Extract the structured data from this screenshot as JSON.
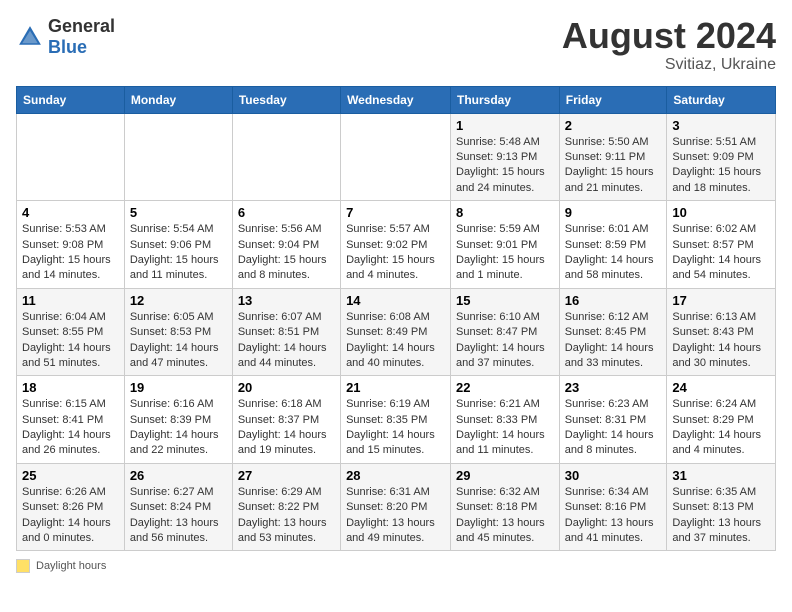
{
  "logo": {
    "general": "General",
    "blue": "Blue"
  },
  "title": "August 2024",
  "subtitle": "Svitiaz, Ukraine",
  "days_of_week": [
    "Sunday",
    "Monday",
    "Tuesday",
    "Wednesday",
    "Thursday",
    "Friday",
    "Saturday"
  ],
  "footer": {
    "label": "Daylight hours"
  },
  "weeks": [
    [
      {
        "day": "",
        "sunrise": "",
        "sunset": "",
        "daylight": ""
      },
      {
        "day": "",
        "sunrise": "",
        "sunset": "",
        "daylight": ""
      },
      {
        "day": "",
        "sunrise": "",
        "sunset": "",
        "daylight": ""
      },
      {
        "day": "",
        "sunrise": "",
        "sunset": "",
        "daylight": ""
      },
      {
        "day": "1",
        "sunrise": "5:48 AM",
        "sunset": "9:13 PM",
        "daylight": "15 hours and 24 minutes."
      },
      {
        "day": "2",
        "sunrise": "5:50 AM",
        "sunset": "9:11 PM",
        "daylight": "15 hours and 21 minutes."
      },
      {
        "day": "3",
        "sunrise": "5:51 AM",
        "sunset": "9:09 PM",
        "daylight": "15 hours and 18 minutes."
      }
    ],
    [
      {
        "day": "4",
        "sunrise": "5:53 AM",
        "sunset": "9:08 PM",
        "daylight": "15 hours and 14 minutes."
      },
      {
        "day": "5",
        "sunrise": "5:54 AM",
        "sunset": "9:06 PM",
        "daylight": "15 hours and 11 minutes."
      },
      {
        "day": "6",
        "sunrise": "5:56 AM",
        "sunset": "9:04 PM",
        "daylight": "15 hours and 8 minutes."
      },
      {
        "day": "7",
        "sunrise": "5:57 AM",
        "sunset": "9:02 PM",
        "daylight": "15 hours and 4 minutes."
      },
      {
        "day": "8",
        "sunrise": "5:59 AM",
        "sunset": "9:01 PM",
        "daylight": "15 hours and 1 minute."
      },
      {
        "day": "9",
        "sunrise": "6:01 AM",
        "sunset": "8:59 PM",
        "daylight": "14 hours and 58 minutes."
      },
      {
        "day": "10",
        "sunrise": "6:02 AM",
        "sunset": "8:57 PM",
        "daylight": "14 hours and 54 minutes."
      }
    ],
    [
      {
        "day": "11",
        "sunrise": "6:04 AM",
        "sunset": "8:55 PM",
        "daylight": "14 hours and 51 minutes."
      },
      {
        "day": "12",
        "sunrise": "6:05 AM",
        "sunset": "8:53 PM",
        "daylight": "14 hours and 47 minutes."
      },
      {
        "day": "13",
        "sunrise": "6:07 AM",
        "sunset": "8:51 PM",
        "daylight": "14 hours and 44 minutes."
      },
      {
        "day": "14",
        "sunrise": "6:08 AM",
        "sunset": "8:49 PM",
        "daylight": "14 hours and 40 minutes."
      },
      {
        "day": "15",
        "sunrise": "6:10 AM",
        "sunset": "8:47 PM",
        "daylight": "14 hours and 37 minutes."
      },
      {
        "day": "16",
        "sunrise": "6:12 AM",
        "sunset": "8:45 PM",
        "daylight": "14 hours and 33 minutes."
      },
      {
        "day": "17",
        "sunrise": "6:13 AM",
        "sunset": "8:43 PM",
        "daylight": "14 hours and 30 minutes."
      }
    ],
    [
      {
        "day": "18",
        "sunrise": "6:15 AM",
        "sunset": "8:41 PM",
        "daylight": "14 hours and 26 minutes."
      },
      {
        "day": "19",
        "sunrise": "6:16 AM",
        "sunset": "8:39 PM",
        "daylight": "14 hours and 22 minutes."
      },
      {
        "day": "20",
        "sunrise": "6:18 AM",
        "sunset": "8:37 PM",
        "daylight": "14 hours and 19 minutes."
      },
      {
        "day": "21",
        "sunrise": "6:19 AM",
        "sunset": "8:35 PM",
        "daylight": "14 hours and 15 minutes."
      },
      {
        "day": "22",
        "sunrise": "6:21 AM",
        "sunset": "8:33 PM",
        "daylight": "14 hours and 11 minutes."
      },
      {
        "day": "23",
        "sunrise": "6:23 AM",
        "sunset": "8:31 PM",
        "daylight": "14 hours and 8 minutes."
      },
      {
        "day": "24",
        "sunrise": "6:24 AM",
        "sunset": "8:29 PM",
        "daylight": "14 hours and 4 minutes."
      }
    ],
    [
      {
        "day": "25",
        "sunrise": "6:26 AM",
        "sunset": "8:26 PM",
        "daylight": "14 hours and 0 minutes."
      },
      {
        "day": "26",
        "sunrise": "6:27 AM",
        "sunset": "8:24 PM",
        "daylight": "13 hours and 56 minutes."
      },
      {
        "day": "27",
        "sunrise": "6:29 AM",
        "sunset": "8:22 PM",
        "daylight": "13 hours and 53 minutes."
      },
      {
        "day": "28",
        "sunrise": "6:31 AM",
        "sunset": "8:20 PM",
        "daylight": "13 hours and 49 minutes."
      },
      {
        "day": "29",
        "sunrise": "6:32 AM",
        "sunset": "8:18 PM",
        "daylight": "13 hours and 45 minutes."
      },
      {
        "day": "30",
        "sunrise": "6:34 AM",
        "sunset": "8:16 PM",
        "daylight": "13 hours and 41 minutes."
      },
      {
        "day": "31",
        "sunrise": "6:35 AM",
        "sunset": "8:13 PM",
        "daylight": "13 hours and 37 minutes."
      }
    ]
  ]
}
